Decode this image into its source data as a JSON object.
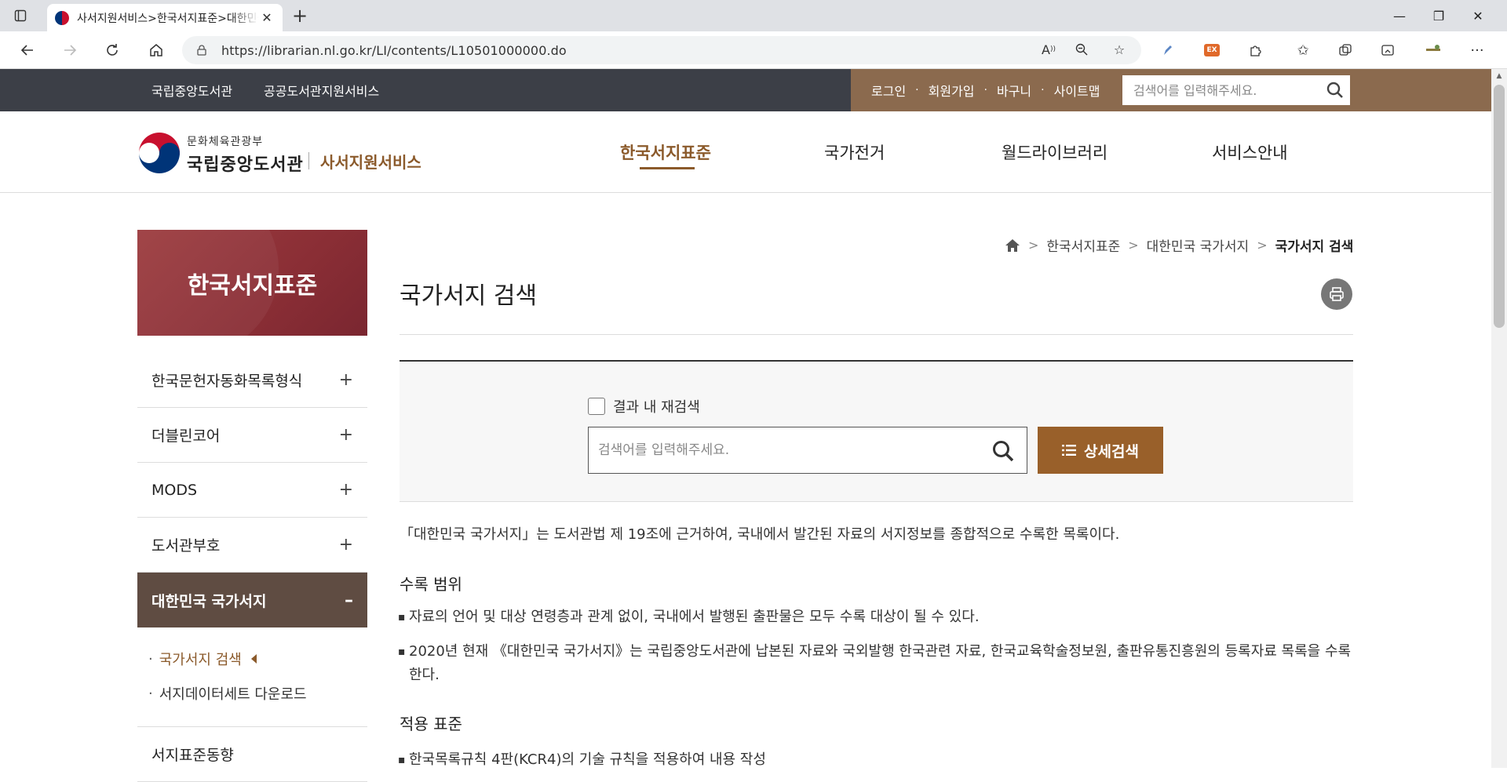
{
  "browser": {
    "tab_title": "사서지원서비스>한국서지표준>대한민국 국가서지>국가서지 검색",
    "url": "https://librarian.nl.go.kr/LI/contents/L10501000000.do"
  },
  "topbar": {
    "links": [
      "국립중앙도서관",
      "공공도서관지원서비스"
    ],
    "menu": [
      "로그인",
      "회원가입",
      "바구니",
      "사이트맵"
    ],
    "search_placeholder": "검색어를 입력해주세요."
  },
  "header": {
    "logo_sub": "문화체육관광부",
    "logo_main": "국립중앙도서관",
    "service_name": "사서지원서비스",
    "nav": [
      "한국서지표준",
      "국가전거",
      "월드라이브러리",
      "서비스안내"
    ],
    "active_nav": "한국서지표준"
  },
  "sidebar": {
    "title": "한국서지표준",
    "items": [
      {
        "label": "한국문헌자동화목록형식",
        "toggle": "+"
      },
      {
        "label": "더블린코어",
        "toggle": "+"
      },
      {
        "label": "MODS",
        "toggle": "+"
      },
      {
        "label": "도서관부호",
        "toggle": "+"
      },
      {
        "label": "대한민국 국가서지",
        "toggle": "–"
      }
    ],
    "sub_items": [
      "국가서지 검색",
      "서지데이터세트 다운로드"
    ],
    "bullet": "·",
    "next_item": "서지표준동향"
  },
  "main": {
    "breadcrumb": [
      "한국서지표준",
      "대한민국 국가서지",
      "국가서지 검색"
    ],
    "title": "국가서지 검색",
    "research_label": "결과 내 재검색",
    "search_placeholder": "검색어를 입력해주세요.",
    "advanced_search_label": "상세검색",
    "intro": "「대한민국 국가서지」는 도서관법 제 19조에 근거하여, 국내에서 발간된 자료의 서지정보를 종합적으로 수록한 목록이다.",
    "sections": [
      {
        "title": "수록 범위",
        "bullets": [
          "자료의 언어 및 대상 연령층과 관계 없이, 국내에서 발행된 출판물은 모두 수록 대상이 될 수 있다.",
          "2020년 현재 《대한민국 국가서지》는 국립중앙도서관에 납본된 자료와 국외발행 한국관련 자료, 한국교육학술정보원, 출판유통진흥원의 등록자료 목록을 수록한다."
        ]
      },
      {
        "title": "적용 표준",
        "bullets": [
          "한국목록규칙 4판(KCR4)의 기술 규칙을 적용하여 내용 작성"
        ]
      }
    ]
  },
  "colors": {
    "brown_accent": "#8b5a2b",
    "topbar_dark": "#3c3f47",
    "topbar_brown": "#8b6a4e",
    "sidebar_hero": "#8a2e35",
    "sidebar_open": "#5f4c42",
    "adv_button": "#99602a"
  }
}
